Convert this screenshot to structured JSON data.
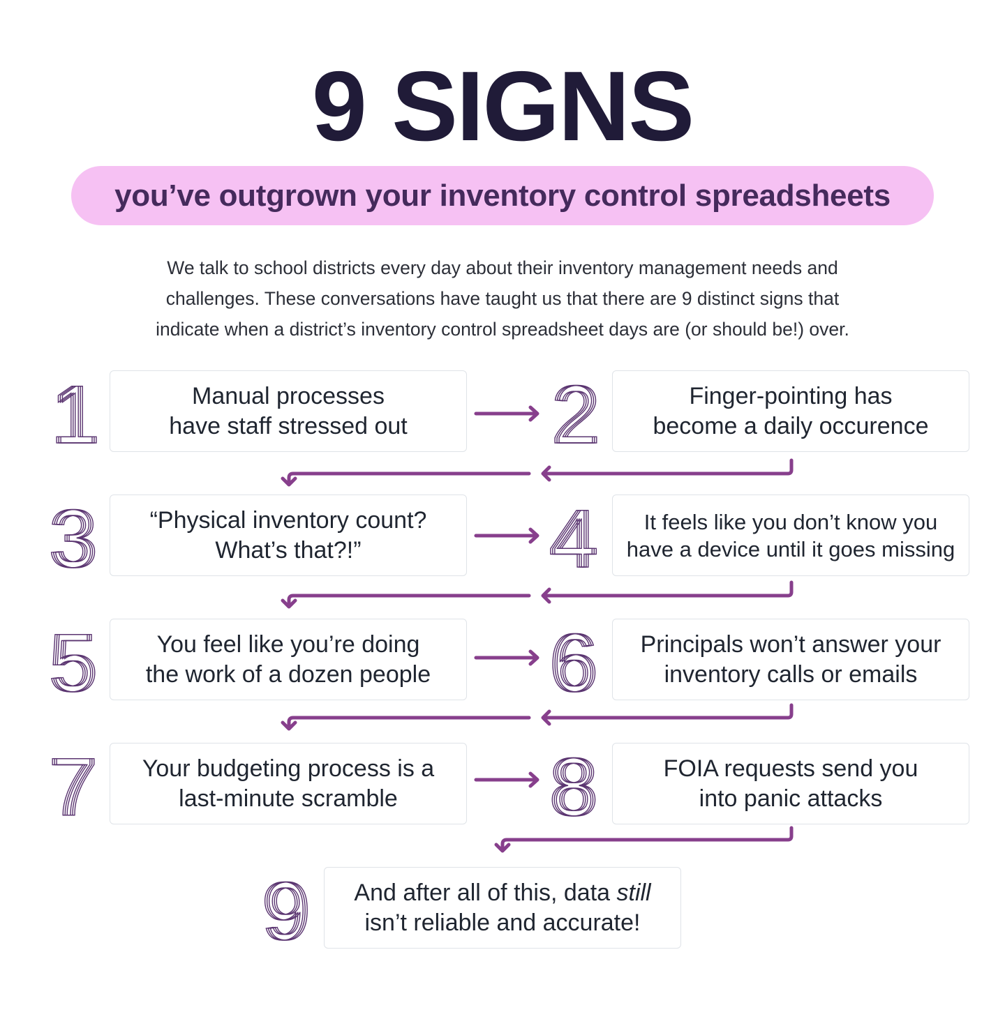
{
  "header": {
    "title": "9 SIGNS",
    "subtitle": "you’ve outgrown your inventory control spreadsheets"
  },
  "intro": {
    "lines": [
      "We talk to school districts every day about their inventory management needs and",
      "challenges. These conversations have taught us that there are 9 distinct signs that",
      "indicate when a district’s inventory control spreadsheet days are (or should be!) over."
    ]
  },
  "colors": {
    "title": "#201b38",
    "pill_bg": "#f6c1f3",
    "pill_text": "#452a5c",
    "arrow": "#873f8c",
    "numeral_stroke": "#5a3470",
    "box_border": "#dfe3e8"
  },
  "signs": [
    {
      "number": "1",
      "line1": "Manual processes",
      "line2": "have staff stressed out"
    },
    {
      "number": "2",
      "line1": "Finger-pointing has",
      "line2": "become a daily occurence"
    },
    {
      "number": "3",
      "line1": "“Physical inventory count?",
      "line2": "What’s that?!”"
    },
    {
      "number": "4",
      "line1": "It feels like you don’t know you",
      "line2": "have a device until it goes missing"
    },
    {
      "number": "5",
      "line1": "You feel like you’re doing",
      "line2": "the work of a dozen people"
    },
    {
      "number": "6",
      "line1": "Principals won’t answer your",
      "line2": "inventory calls or emails"
    },
    {
      "number": "7",
      "line1": "Your budgeting process is a",
      "line2": "last-minute scramble"
    },
    {
      "number": "8",
      "line1": "FOIA requests send you",
      "line2": "into panic attacks"
    },
    {
      "number": "9",
      "line1_pre": "And after all of this, data ",
      "line1_em": "still",
      "line2": "isn’t reliable and accurate!"
    }
  ]
}
